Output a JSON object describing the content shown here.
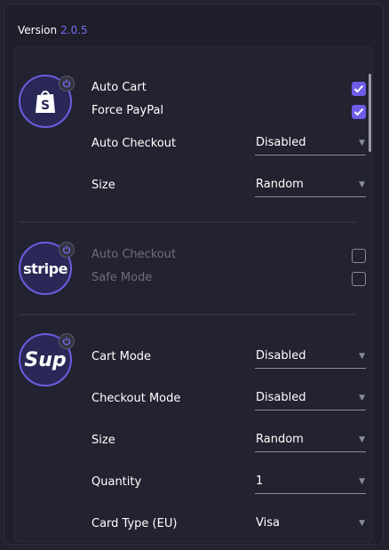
{
  "version": {
    "label": "Version",
    "number": "2.0.5"
  },
  "colors": {
    "accent": "#6c5ce7",
    "panel_bg": "#1f1f2b",
    "logo_bg": "#2a2856"
  },
  "shopify": {
    "icon": "shopify-bag-icon",
    "auto_cart": {
      "label": "Auto Cart",
      "checked": true
    },
    "force_paypal": {
      "label": "Force PayPal",
      "checked": true
    },
    "auto_checkout": {
      "label": "Auto Checkout",
      "value": "Disabled"
    },
    "size": {
      "label": "Size",
      "value": "Random"
    }
  },
  "stripe": {
    "logo_text": "stripe",
    "auto_checkout": {
      "label": "Auto Checkout",
      "checked": false
    },
    "safe_mode": {
      "label": "Safe Mode",
      "checked": false
    }
  },
  "supreme": {
    "logo_text": "Sup",
    "cart_mode": {
      "label": "Cart Mode",
      "value": "Disabled"
    },
    "checkout_mode": {
      "label": "Checkout Mode",
      "value": "Disabled"
    },
    "size": {
      "label": "Size",
      "value": "Random"
    },
    "quantity": {
      "label": "Quantity",
      "value": "1"
    },
    "card_type": {
      "label": "Card Type (EU)",
      "value": "Visa"
    }
  }
}
